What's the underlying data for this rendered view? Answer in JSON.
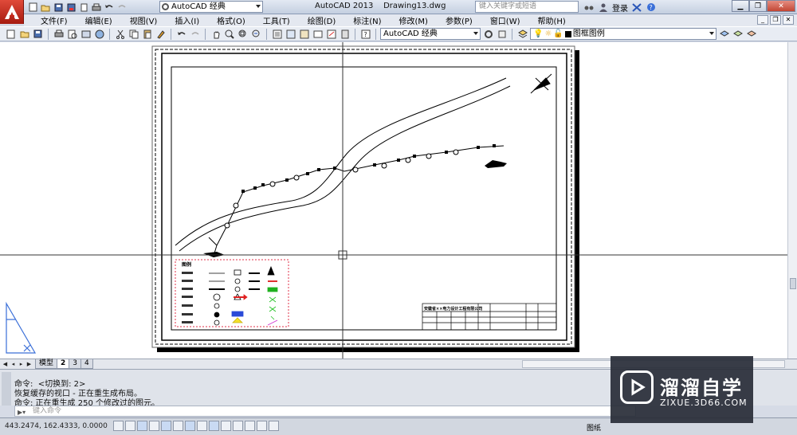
{
  "app": {
    "title_app": "AutoCAD 2013",
    "title_file": "Drawing13.dwg",
    "workspace": "AutoCAD 经典",
    "search_placeholder": "键入关键字或短语",
    "login": "登录"
  },
  "menu": [
    "文件(F)",
    "编辑(E)",
    "视图(V)",
    "插入(I)",
    "格式(O)",
    "工具(T)",
    "绘图(D)",
    "标注(N)",
    "修改(M)",
    "参数(P)",
    "窗口(W)",
    "帮助(H)"
  ],
  "toolbar": {
    "workspace_combo": "AutoCAD 经典",
    "layer_combo": "图框图例"
  },
  "drawing": {
    "company": "安徽省××电力设计工程有限公司",
    "legend_title": "图例"
  },
  "layout_tabs": [
    "模型",
    "2",
    "3",
    "4"
  ],
  "command_history": [
    "命令:  <切换到: 2>",
    "恢复缓存的视口 - 正在重生成布局。",
    "命令: 正在重生成 250 个修改过的图元。"
  ],
  "command_input_placeholder": "键入命令",
  "status": {
    "coordinates": "443.2474,  162.4333,  0.0000",
    "paper_label": "图纸"
  },
  "watermark": {
    "title": "溜溜自学",
    "url": "ZIXUE.3D66.COM"
  },
  "colors": {
    "app_logo": "#c8281a",
    "legend_border": "#e0304a",
    "ucs_icon": "#3a6fd8",
    "watermark_bg": "#282d37"
  }
}
